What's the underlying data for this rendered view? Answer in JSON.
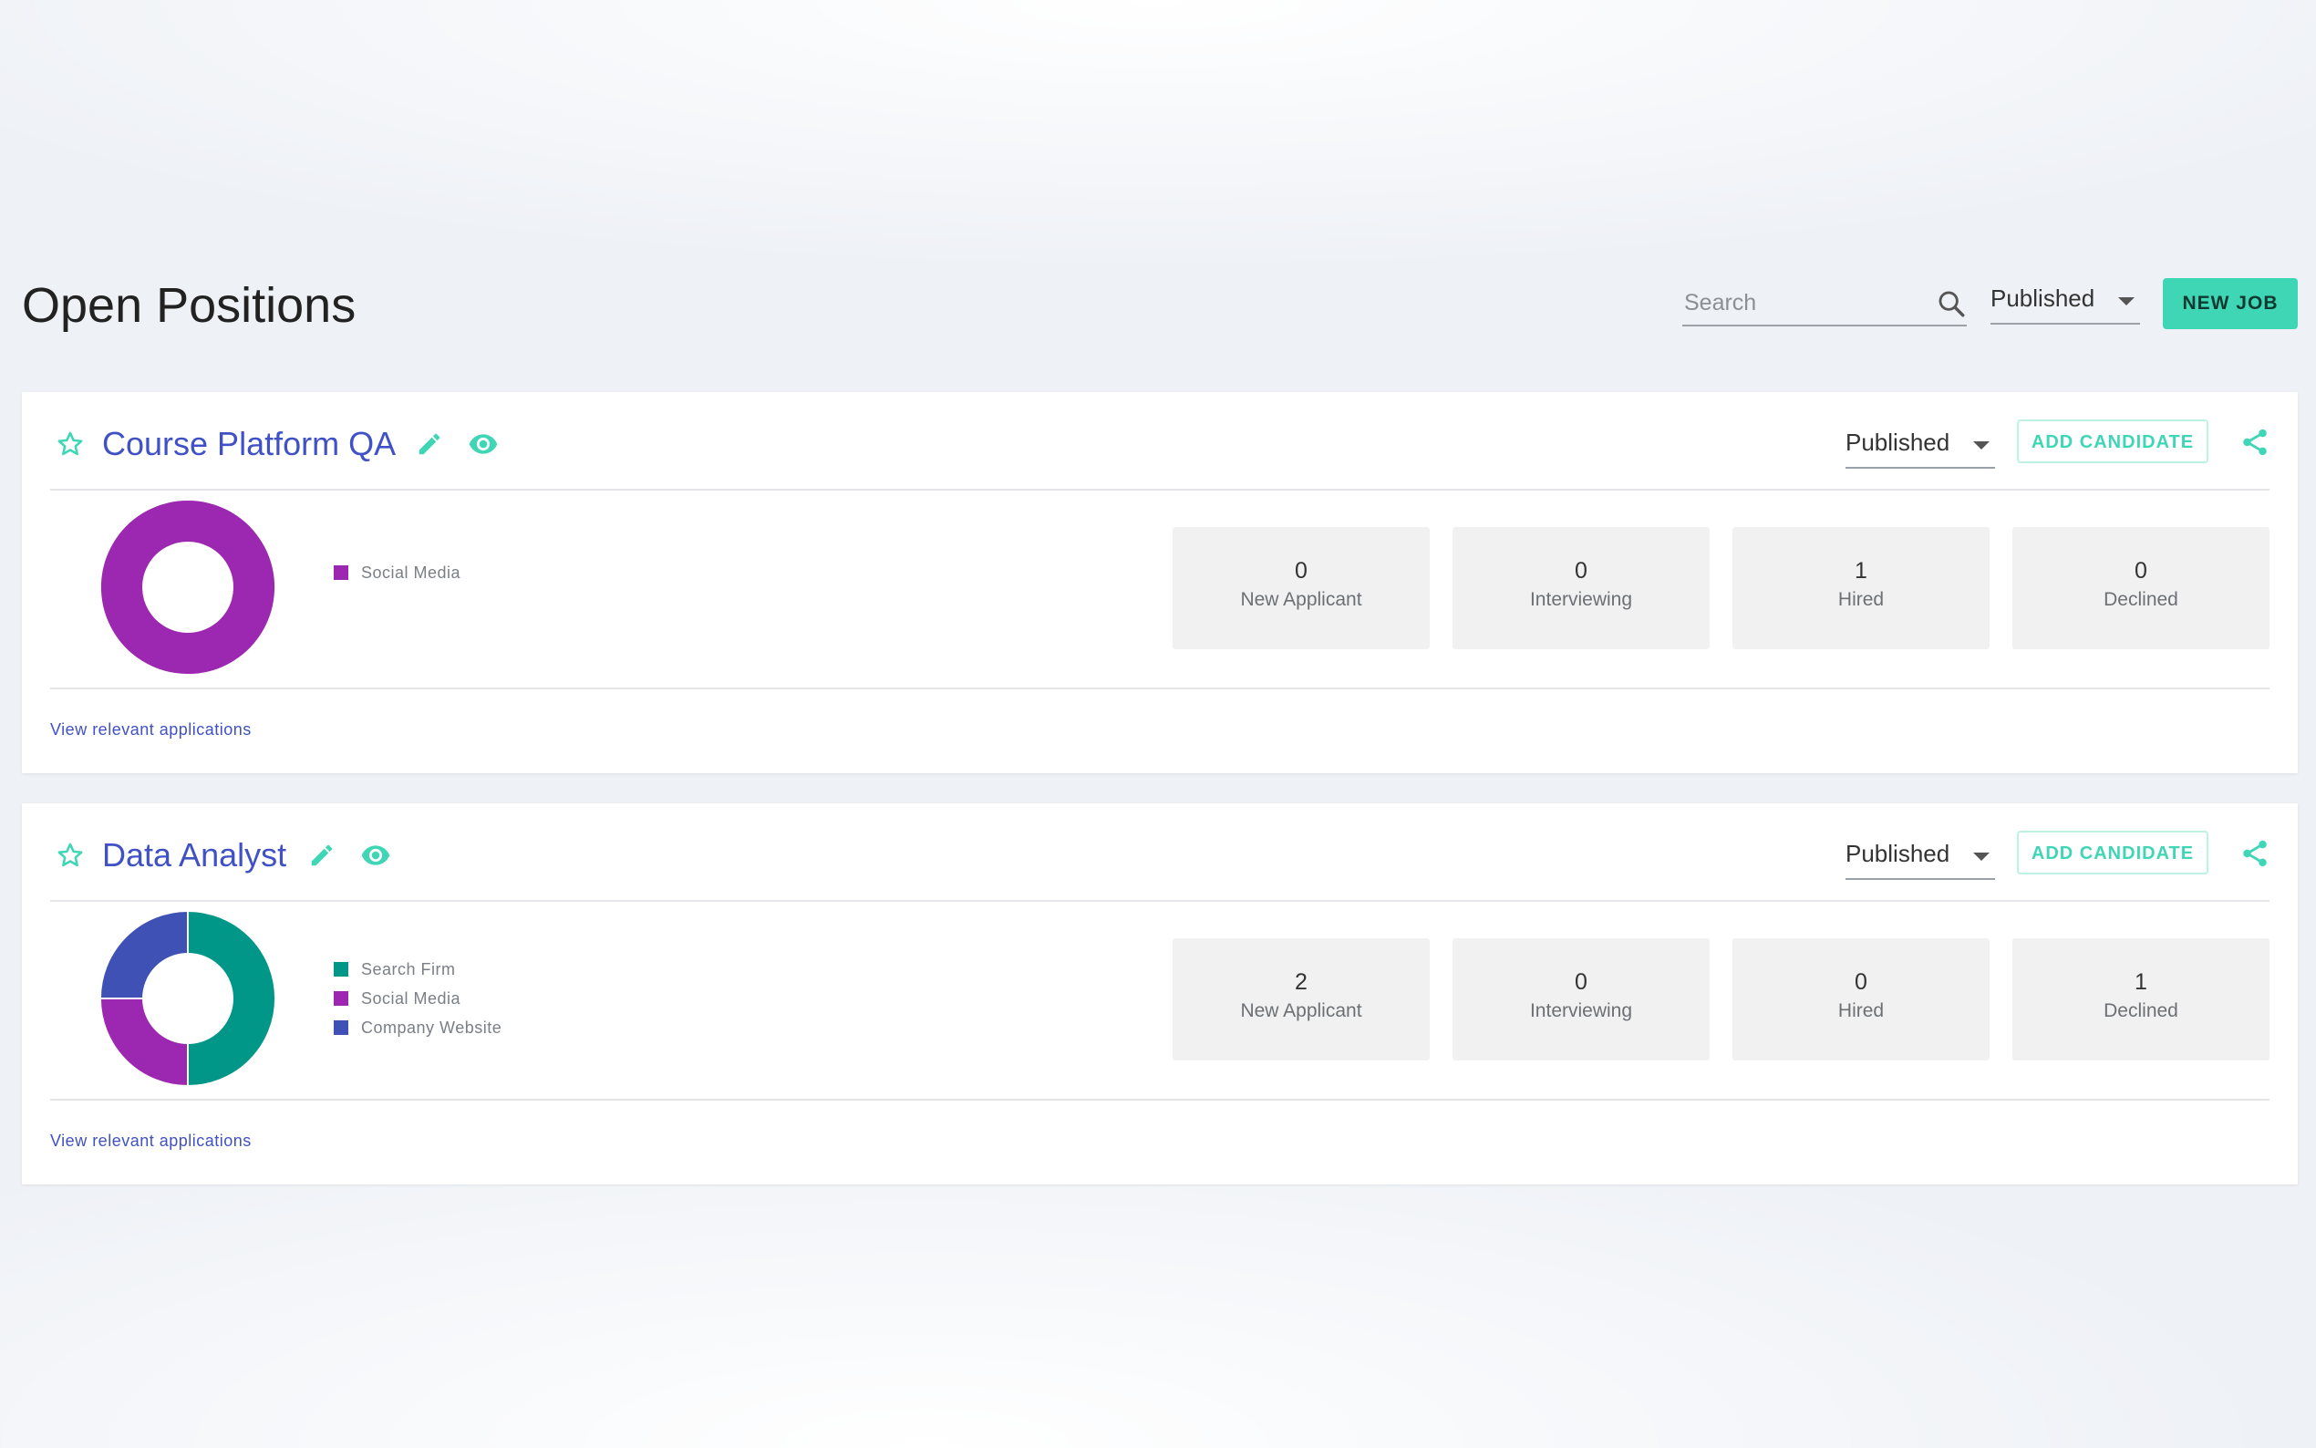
{
  "header": {
    "title": "Open Positions",
    "search_placeholder": "Search",
    "status_filter": "Published",
    "new_job_label": "NEW JOB"
  },
  "colors": {
    "accent": "#3fd6b6",
    "title_blue": "#3f51c5",
    "search_firm": "#009688",
    "social_media": "#9c27b0",
    "company_website": "#3f51b5"
  },
  "jobs": [
    {
      "title": "Course Platform QA",
      "status": "Published",
      "add_candidate_label": "ADD CANDIDATE",
      "legend": [
        "Social Media"
      ],
      "stats": [
        {
          "value": "0",
          "label": "New Applicant"
        },
        {
          "value": "0",
          "label": "Interviewing"
        },
        {
          "value": "1",
          "label": "Hired"
        },
        {
          "value": "0",
          "label": "Declined"
        }
      ],
      "link": "View relevant applications"
    },
    {
      "title": "Data Analyst",
      "status": "Published",
      "add_candidate_label": "ADD CANDIDATE",
      "legend": [
        "Search Firm",
        "Social Media",
        "Company Website"
      ],
      "stats": [
        {
          "value": "2",
          "label": "New Applicant"
        },
        {
          "value": "0",
          "label": "Interviewing"
        },
        {
          "value": "0",
          "label": "Hired"
        },
        {
          "value": "1",
          "label": "Declined"
        }
      ],
      "link": "View relevant applications"
    }
  ],
  "chart_data": [
    {
      "type": "pie",
      "donut": true,
      "categories": [
        "Social Media"
      ],
      "values": [
        1
      ],
      "colors": [
        "#9c27b0"
      ]
    },
    {
      "type": "pie",
      "donut": true,
      "categories": [
        "Search Firm",
        "Social Media",
        "Company Website"
      ],
      "values": [
        2,
        1,
        1
      ],
      "colors": [
        "#009688",
        "#9c27b0",
        "#3f51b5"
      ]
    }
  ]
}
